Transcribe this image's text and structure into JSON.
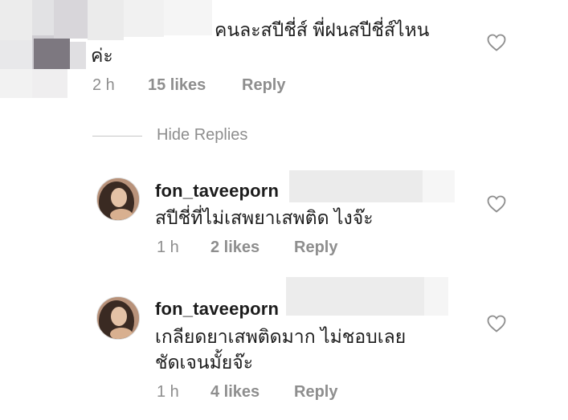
{
  "top_comment": {
    "text_line1": "คนละสปีชี่ส์ พี่ฝนสปีชี่ส์ไหน",
    "text_line2": "ค่ะ",
    "time": "2 h",
    "likes": "15 likes",
    "reply_label": "Reply"
  },
  "hide_replies_label": "Hide Replies",
  "replies": [
    {
      "username": "fon_taveeporn",
      "text_lines": [
        "สปีชี่ที่ไม่เสพยาเสพติด ไงจ๊ะ"
      ],
      "time": "1 h",
      "likes": "2 likes",
      "reply_label": "Reply"
    },
    {
      "username": "fon_taveeporn",
      "text_lines": [
        "เกลียดยาเสพติดมาก ไม่ชอบเลย",
        "ชัดเจนมั้ยจ๊ะ"
      ],
      "time": "1 h",
      "likes": "4 likes",
      "reply_label": "Reply"
    }
  ],
  "colors": {
    "meta_gray": "#8e8e8e",
    "text": "#1c1c1c",
    "heart_stroke": "#8e8e8e"
  },
  "icons": {
    "like": "heart-outline-icon"
  }
}
